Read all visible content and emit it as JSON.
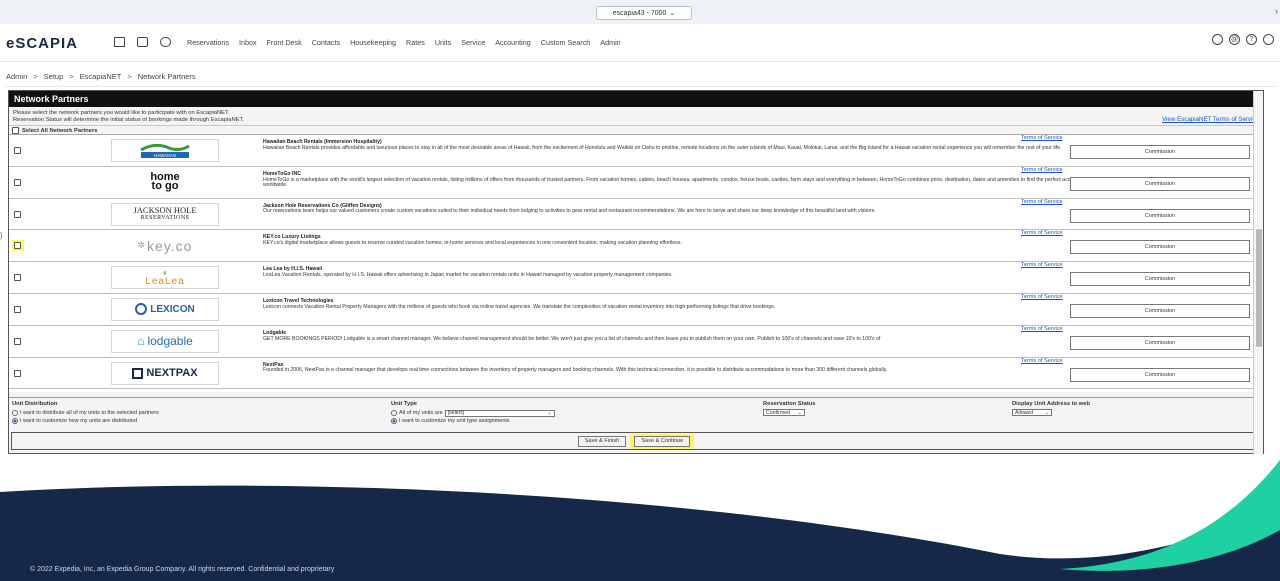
{
  "topbar": {
    "env_selector": "escapia43 - 7000",
    "env_caret": "⌄",
    "edge_arrow": "›"
  },
  "app": {
    "logo": "eSCAPIA"
  },
  "nav": {
    "icons": [
      "home-icon",
      "calendar-icon",
      "car-icon"
    ],
    "items": [
      "Reservations",
      "Inbox",
      "Front Desk",
      "Contacts",
      "Housekeeping",
      "Rates",
      "Units",
      "Service",
      "Accounting",
      "Custom Search",
      "Admin"
    ],
    "right_icons": [
      "search-icon",
      "at-icon",
      "help-icon",
      "user-icon"
    ]
  },
  "breadcrumb": [
    "Admin",
    "Setup",
    "EscapiaNET",
    "Network Partners"
  ],
  "breadcrumb_sep": ">",
  "panel": {
    "title": "Network Partners",
    "intro_line1": "Please select the network partners you would like to participate with on EscapiaNET.",
    "intro_line2": "Reservation Status will determine the initial status of bookings made through EscapiaNET.",
    "terms_link": "View EscapiaNET Terms of Service",
    "select_all": "Select All Network Partners"
  },
  "partners": [
    {
      "name": "Hawaiian Beach Rentals (Immersion Hospitality)",
      "desc": "Hawaiian Beach Rentals provides affordable and luxurious places to stay in all of the most desirable areas of Hawaii, from the excitement of Honolulu and Waikiki on Oahu to pristine, remote locations on the outer islands of Maui, Kauai, Molokai, Lanai, and the Big Island for a Hawaii vacation rental experience you will remember the rest of your life.",
      "logo": "HAWAIIAN",
      "tos": "Terms of Service",
      "commission": "Commission",
      "highlighted": false
    },
    {
      "name": "HomeToGo INC",
      "desc": "HomeToGo is a marketplace with the world's largest selection of vacation rentals, listing millions of offers from thousands of trusted partners. From vacation homes, cabins, beach houses, apartments, condos, house boats, castles, farm stays and everything in between, HomeToGo combines price, destination, dates and amenities to find the perfect accommodation for any trip worldwide.",
      "logo_line1": "home",
      "logo_line2": "to go",
      "tos": "Terms of Service",
      "commission": "Commission",
      "highlighted": false
    },
    {
      "name": "Jackson Hole Reservations Co (Gliffen Designs)",
      "desc": "Our reservations team helps our valued customers create custom vacations suited to their individual needs from lodging to activities to gear rental and restaurant recommendations. We are here to serve and share our deep knowledge of this beautiful land with visitors.",
      "logo_line1": "JACKSON HOLE",
      "logo_line2": "RESERVATIONS",
      "tos": "Terms of Service",
      "commission": "Commission",
      "highlighted": false
    },
    {
      "name": "KEY.co Luxury Listings",
      "desc": "KEY.co's digital marketplace allows guests to reserve curated vacation homes, in-home services and local experiences in one convenient location, making vacation planning effortless.",
      "logo": "key.co",
      "tos": "Terms of Service",
      "commission": "Commission",
      "highlighted": true
    },
    {
      "name": "Lea Lea by H.I.S. Hawaii",
      "desc": "LeaLea Vacation Rentals, operated by H.I.S. Hawaii offers advertising in Japan market for vacation rentals units in Hawaii managed by vacation property management companies.",
      "logo": "LeaLea",
      "tos": "Terms of Service",
      "commission": "Commission",
      "highlighted": false
    },
    {
      "name": "Lexicon Travel Technologies",
      "desc": "Lexicon connects Vacation Rental Property Managers with the millions of guests who book via online travel agencies. We translate the complexities of vacation rental inventory into high performing listings that drive bookings.",
      "logo": "LEXICON",
      "tos": "Terms of Service",
      "commission": "Commission",
      "highlighted": false
    },
    {
      "name": "Lodgable",
      "desc": "GET MORE BOOKINGS PERIOD! Lodgable is a smart channel manager. We believe channel management should be better. We won't just give you a list of channels and then leave you to publish them on your own. Publish to 100's of channels and save 10's to 100's of",
      "logo": "lodgable",
      "tos": "Terms of Service",
      "commission": "Commission",
      "highlighted": false
    },
    {
      "name": "NextPax",
      "desc": "Founded in 2006, NextPax is a channel manager that develops real time connections between the inventory of property managers and booking channels. With this technical connection, it is possible to distribute accommodations to more than 300 different channels globally.",
      "logo": "NEXTPAX",
      "tos": "Terms of Service",
      "commission": "Commission",
      "highlighted": false
    }
  ],
  "settings": {
    "unit_distribution": {
      "label": "Unit Distribution",
      "opt1": "I want to distribute all of my units to the selected partners",
      "opt2": "I want to customize how my units are distributed"
    },
    "unit_type": {
      "label": "Unit Type",
      "opt1": "All of my units are",
      "select_value": "[select]",
      "opt2": "I want to customize my unit type assignments"
    },
    "reservation_status": {
      "label": "Reservation Status",
      "value": "Confirmed"
    },
    "display_address": {
      "label": "Display Unit Address to web",
      "value": "Allowed"
    }
  },
  "actions": {
    "save_finish": "Save & Finish",
    "save_continue": "Save & Continue"
  },
  "footer": {
    "copyright": "© 2022 Expedia, Inc, an Expedia Group Company. All rights reserved. Confidential and proprietary"
  },
  "colors": {
    "highlight": "#fff36a",
    "link": "#1a55c4",
    "footer_navy": "#16284a",
    "footer_teal": "#1fd0a3"
  }
}
